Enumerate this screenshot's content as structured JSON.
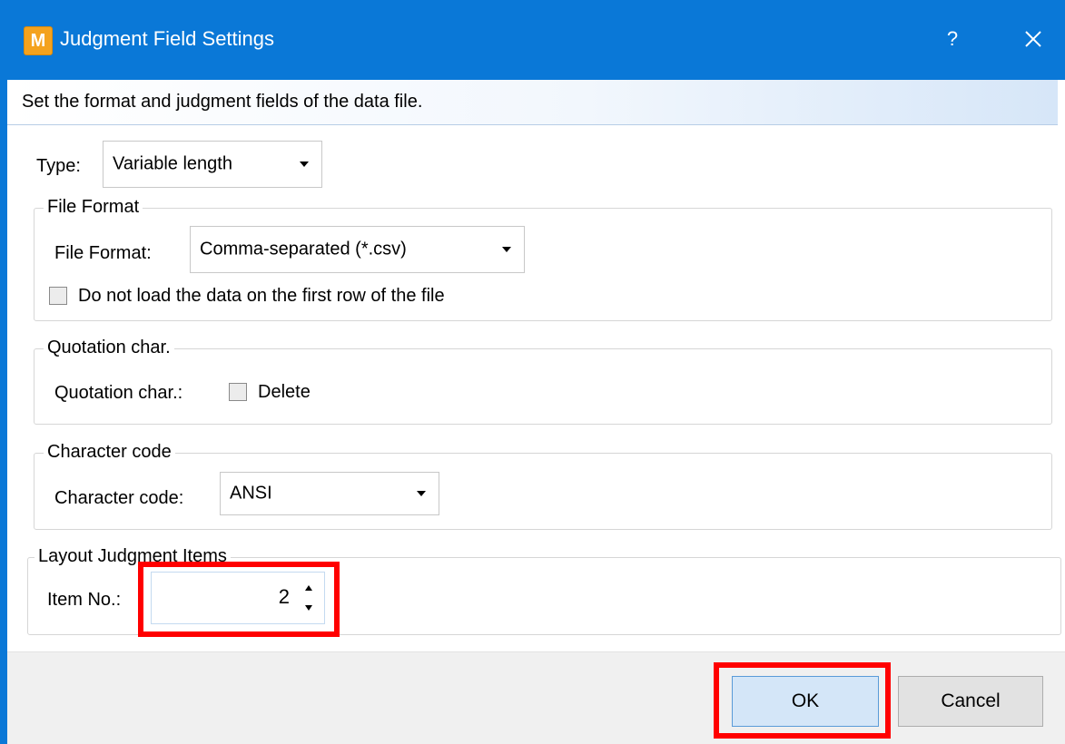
{
  "window": {
    "app_icon_letter": "M",
    "title": "Judgment Field Settings",
    "help_label": "?"
  },
  "instruction": "Set the format and judgment fields of the data file.",
  "type": {
    "label": "Type:",
    "value": "Variable length"
  },
  "file_format_group": {
    "title": "File Format",
    "label": "File Format:",
    "value": "Comma-separated (*.csv)",
    "skip_first_row": {
      "label": "Do not load the data on the first row of the file",
      "checked": false
    }
  },
  "quotation_group": {
    "title": "Quotation char.",
    "label": "Quotation char.:",
    "delete": {
      "label": "Delete",
      "checked": false
    }
  },
  "charcode_group": {
    "title": "Character code",
    "label": "Character code:",
    "value": "ANSI"
  },
  "layout_group": {
    "title": "Layout Judgment Items",
    "item_no_label": "Item No.:",
    "item_no_value": "2"
  },
  "buttons": {
    "ok": "OK",
    "cancel": "Cancel"
  },
  "colors": {
    "titlebar": "#0a78d7",
    "highlight": "#ff0000"
  }
}
